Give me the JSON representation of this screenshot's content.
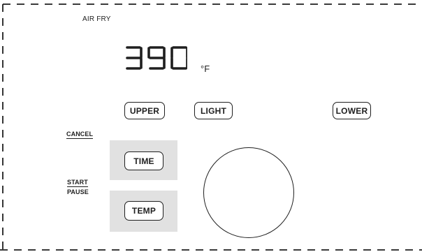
{
  "display": {
    "mode": "AIR FRY",
    "temperature": "390",
    "unit": "°F"
  },
  "buttons": {
    "upper": "UPPER",
    "light": "LIGHT",
    "lower": "LOWER",
    "time": "TIME",
    "temp": "TEMP"
  },
  "labels": {
    "cancel": "CANCEL",
    "start": "START",
    "pause": "PAUSE"
  },
  "colors": {
    "ink": "#1f1f1f",
    "tile": "#e1e1e1",
    "background": "#ffffff"
  }
}
